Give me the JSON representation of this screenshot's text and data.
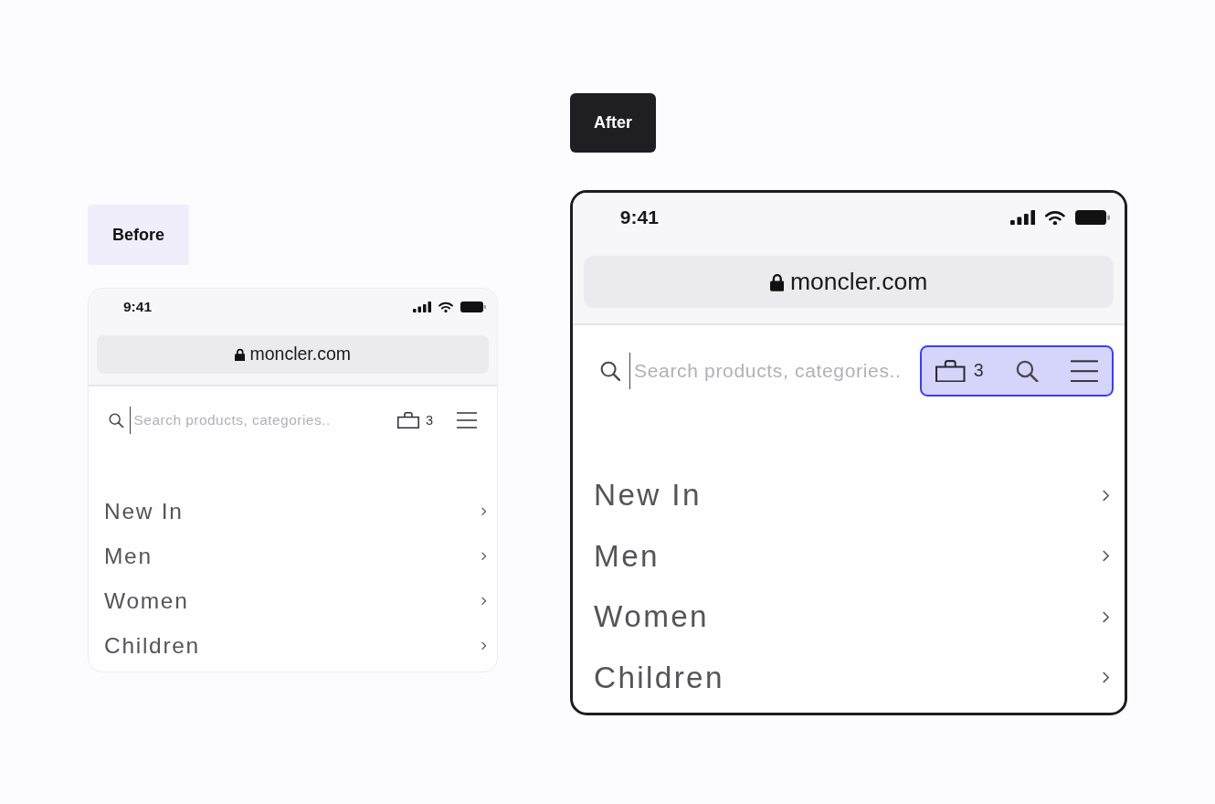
{
  "panels": [
    {
      "kind": "before",
      "label": "Before",
      "phone": {
        "status_bar": {
          "time": "9:41"
        },
        "address_bar": {
          "url": "moncler.com"
        },
        "header": {
          "search": {
            "placeholder": "Search products, categories.."
          },
          "highlighted": false,
          "actions": [
            {
              "kind": "bag",
              "count": "3"
            },
            {
              "kind": "menu"
            }
          ]
        },
        "menu": [
          "New In",
          "Men",
          "Women",
          "Children"
        ]
      }
    },
    {
      "kind": "after",
      "label": "After",
      "phone": {
        "status_bar": {
          "time": "9:41"
        },
        "address_bar": {
          "url": "moncler.com"
        },
        "header": {
          "search": {
            "placeholder": "Search products, categories.."
          },
          "highlighted": true,
          "actions": [
            {
              "kind": "bag",
              "count": "3"
            },
            {
              "kind": "search"
            },
            {
              "kind": "menu"
            }
          ]
        },
        "menu": [
          "New In",
          "Men",
          "Women",
          "Children"
        ]
      }
    }
  ]
}
